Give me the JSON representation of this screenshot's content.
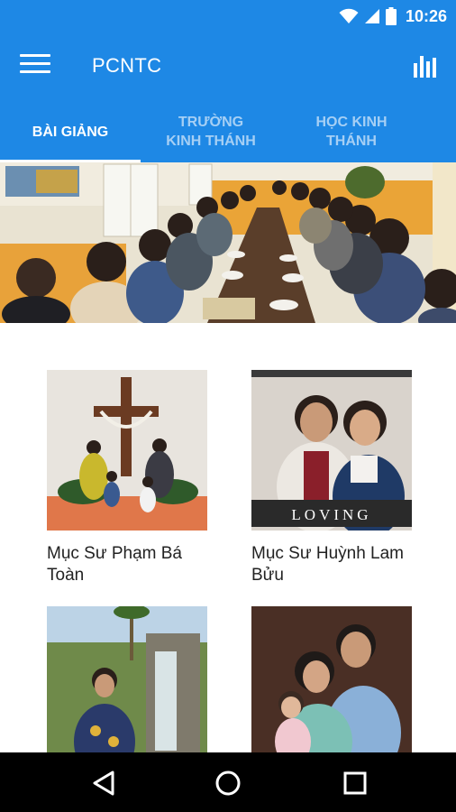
{
  "status_bar": {
    "time": "10:26",
    "icons": [
      "wifi-icon",
      "signal-icon",
      "battery-icon"
    ]
  },
  "app_bar": {
    "title": "PCNTC",
    "menu_icon": "menu-icon",
    "action_icon": "bar-chart-icon"
  },
  "tabs": [
    {
      "label": "Bài Giảng",
      "active": true
    },
    {
      "label": "Trường\nKinh Thánh",
      "active": false
    },
    {
      "label": "Học Kinh\nThánh",
      "active": false
    }
  ],
  "grid": {
    "items": [
      {
        "name": "Mục Sư Phạm Bá Toàn"
      },
      {
        "name": "Mục Sư Huỳnh Lam Bửu"
      },
      {
        "name": ""
      },
      {
        "name": ""
      }
    ],
    "loving_caption": "LOVING"
  },
  "nav_bar": {
    "icons": [
      "back-icon",
      "home-icon",
      "recents-icon"
    ]
  },
  "colors": {
    "primary": "#1e88e5",
    "nav": "#000000"
  }
}
